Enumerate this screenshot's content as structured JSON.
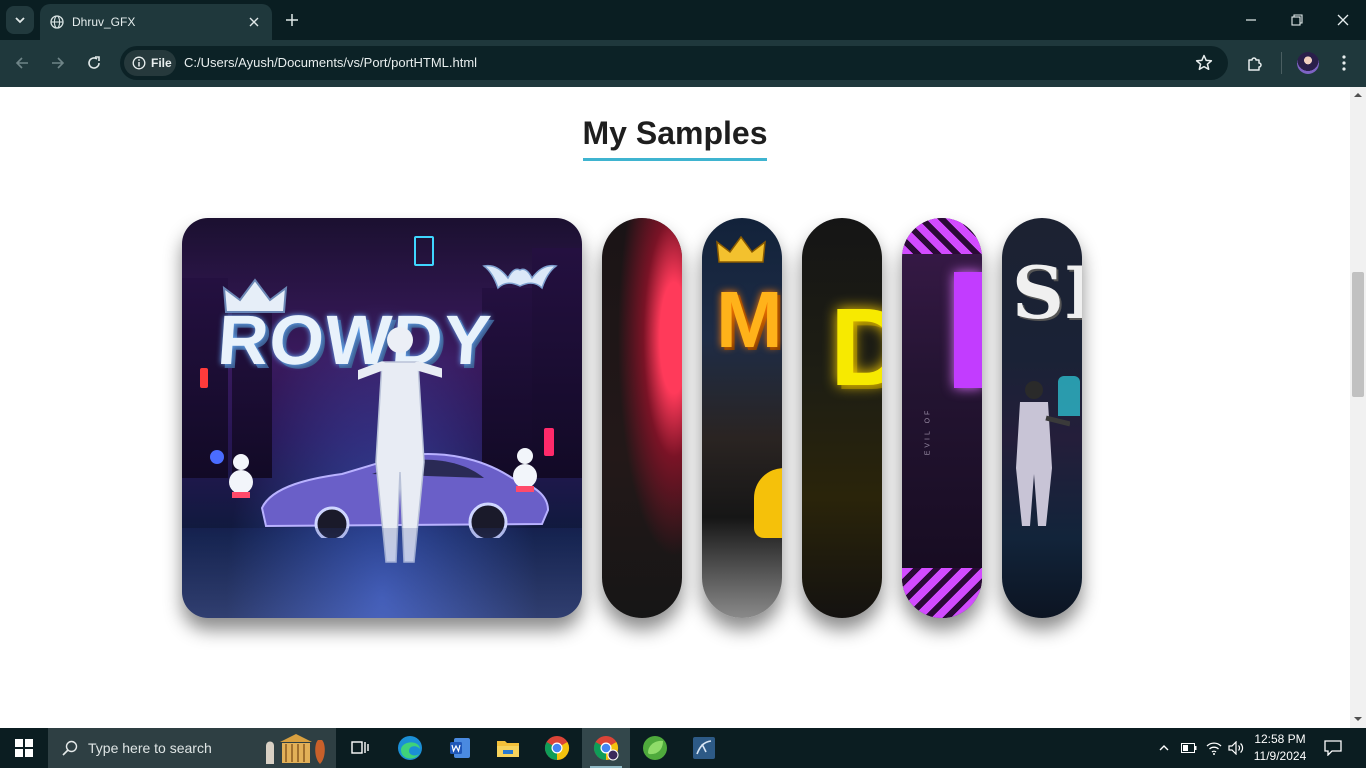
{
  "browser": {
    "tab_title": "Dhruv_GFX",
    "site_chip_label": "File",
    "url": "C:/Users/Ayush/Documents/vs/Port/portHTML.html"
  },
  "page": {
    "heading": "My Samples",
    "accent_color": "#3fb4d0",
    "samples": [
      {
        "id": "rowdy",
        "title_text": "ROWDY",
        "expanded": true
      },
      {
        "id": "sample-2",
        "expanded": false
      },
      {
        "id": "sample-3",
        "letter": "M",
        "expanded": false
      },
      {
        "id": "sample-4",
        "letter": "D",
        "expanded": false
      },
      {
        "id": "sample-5",
        "side_text": "EVIL OF",
        "expanded": false
      },
      {
        "id": "sample-6",
        "letter": "SE",
        "expanded": false
      }
    ]
  },
  "taskbar": {
    "search_placeholder": "Type here to search",
    "time": "12:58 PM",
    "date": "11/9/2024"
  }
}
